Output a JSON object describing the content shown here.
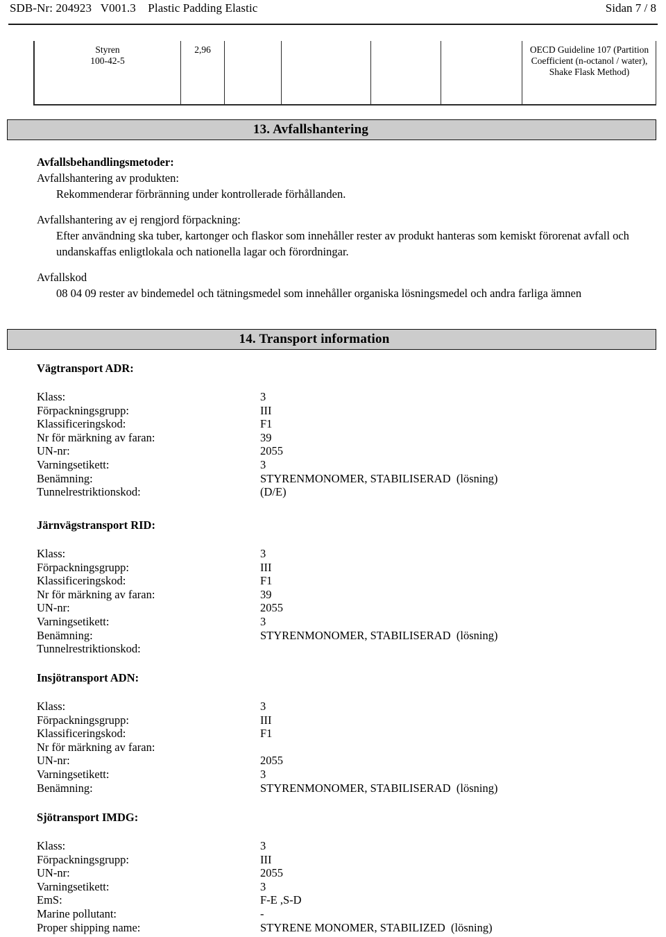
{
  "header": {
    "left": "SDB-Nr: 204923   V001.3    Plastic Padding Elastic",
    "right": "Sidan 7 / 8"
  },
  "table": {
    "row": {
      "substance_name": "Styren",
      "cas_number": "100-42-5",
      "value": "2,96",
      "col4": "",
      "col5": "",
      "col6": "",
      "col7": "",
      "method": "OECD Guideline 107 (Partition Coefficient (n-octanol / water), Shake Flask Method)"
    }
  },
  "section13": {
    "title": "13. Avfallshantering",
    "methods_heading": "Avfallsbehandlingsmetoder:",
    "product_disposal": {
      "lead": "Avfallshantering av produkten:",
      "body": "Rekommenderar förbränning under kontrollerade förhållanden."
    },
    "packaging_disposal": {
      "lead": "Avfallshantering av ej rengjord förpackning:",
      "body": "Efter användning ska tuber, kartonger och flaskor som innehåller rester av produkt hanteras som kemiskt förorenat avfall och undanskaffas enligtlokala och nationella lagar och förordningar."
    },
    "waste_code": {
      "lead": "Avfallskod",
      "body": "08 04 09 rester av bindemedel och tätningsmedel som innehåller organiska lösningsmedel och andra farliga ämnen"
    }
  },
  "section14": {
    "title": "14. Transport information",
    "modes": [
      {
        "name": "adr",
        "title": "Vägtransport ADR:",
        "rows": [
          {
            "label": "Klass:",
            "value": "3"
          },
          {
            "label": "Förpackningsgrupp:",
            "value": "III"
          },
          {
            "label": "Klassificeringskod:",
            "value": "F1"
          },
          {
            "label": "Nr för märkning av faran:",
            "value": "39"
          },
          {
            "label": "UN-nr:",
            "value": "2055"
          },
          {
            "label": "Varningsetikett:",
            "value": "3"
          },
          {
            "label": "Benämning:",
            "value": "STYRENMONOMER, STABILISERAD  (lösning)"
          },
          {
            "label": "Tunnelrestriktionskod:",
            "value": "(D/E)"
          }
        ]
      },
      {
        "name": "rid",
        "title": "Järnvägstransport RID:",
        "rows": [
          {
            "label": "Klass:",
            "value": "3"
          },
          {
            "label": "Förpackningsgrupp:",
            "value": "III"
          },
          {
            "label": "Klassificeringskod:",
            "value": "F1"
          },
          {
            "label": "Nr för märkning av faran:",
            "value": "39"
          },
          {
            "label": "UN-nr:",
            "value": "2055"
          },
          {
            "label": "Varningsetikett:",
            "value": "3"
          },
          {
            "label": "Benämning:",
            "value": "STYRENMONOMER, STABILISERAD  (lösning)"
          },
          {
            "label": "Tunnelrestriktionskod:",
            "value": ""
          }
        ]
      },
      {
        "name": "adn",
        "title": "Insjötransport ADN:",
        "rows": [
          {
            "label": "Klass:",
            "value": "3"
          },
          {
            "label": "Förpackningsgrupp:",
            "value": "III"
          },
          {
            "label": "Klassificeringskod:",
            "value": "F1"
          },
          {
            "label": "Nr för märkning av faran:",
            "value": ""
          },
          {
            "label": "UN-nr:",
            "value": "2055"
          },
          {
            "label": "Varningsetikett:",
            "value": "3"
          },
          {
            "label": "Benämning:",
            "value": "STYRENMONOMER, STABILISERAD  (lösning)"
          }
        ]
      },
      {
        "name": "imdg",
        "title": "Sjötransport IMDG:",
        "rows": [
          {
            "label": "Klass:",
            "value": "3"
          },
          {
            "label": "Förpackningsgrupp:",
            "value": "III"
          },
          {
            "label": "UN-nr:",
            "value": "2055"
          },
          {
            "label": "Varningsetikett:",
            "value": "3"
          },
          {
            "label": "EmS:",
            "value": "F-E ,S-D"
          },
          {
            "label": "Marine pollutant:",
            "value": "-"
          },
          {
            "label": "Proper shipping name:",
            "value": "STYRENE MONOMER, STABILIZED  (lösning)"
          }
        ]
      }
    ]
  },
  "colors": {
    "section_bar_fill": "#cccccc",
    "rule": "#1a1a1a",
    "text": "#000000"
  }
}
